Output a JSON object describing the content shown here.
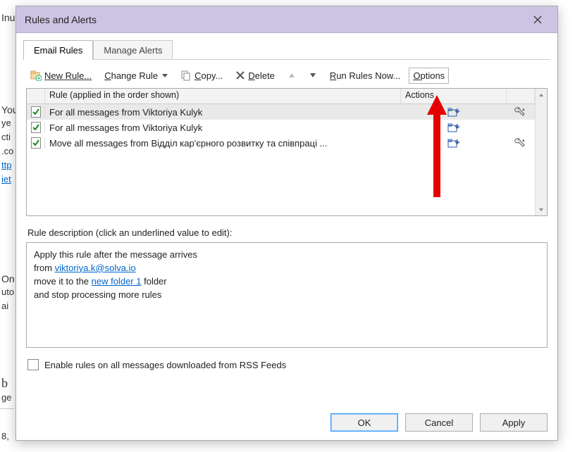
{
  "background": {
    "l1": "Inu",
    "l2": "You",
    "l3": "ye",
    "l4": "cti",
    "l5": ".co",
    "l6": "ttp",
    "l7": "iet",
    "l8": "On",
    "l9": "uto",
    "l10": "ai",
    "l11": "b",
    "l12": "ge",
    "l13": "8,"
  },
  "dialog_title": "Rules and Alerts",
  "tabs": [
    "Email Rules",
    "Manage Alerts"
  ],
  "active_tab": 0,
  "toolbar": {
    "new_rule": "New Rule...",
    "change_rule": "Change Rule",
    "copy": "Copy...",
    "delete": "Delete",
    "run_rules": "Run Rules Now...",
    "options": "Options"
  },
  "columns": {
    "rule": "Rule (applied in the order shown)",
    "actions": "Actions"
  },
  "rules": [
    {
      "checked": true,
      "selected": true,
      "name": "For all messages from Viktoriya Kulyk",
      "has_action_icon": true,
      "has_tool_icon": true
    },
    {
      "checked": true,
      "selected": false,
      "name": "For all messages from Viktoriya Kulyk",
      "has_action_icon": true,
      "has_tool_icon": false
    },
    {
      "checked": true,
      "selected": false,
      "name": "Move all messages from Відділ кар'єрного розвитку та співпраці ...",
      "has_action_icon": true,
      "has_tool_icon": true
    }
  ],
  "description_label": "Rule description (click an underlined value to edit):",
  "description": {
    "line1": "Apply this rule after the message arrives",
    "line2a": "from ",
    "line2_link": "viktoriya.k@solva.io",
    "line3a": "move it to the ",
    "line3_link": "new folder 1",
    "line3b": " folder",
    "line4": " and stop processing more rules"
  },
  "rss_checkbox_label": "Enable rules on all messages downloaded from RSS Feeds",
  "rss_checked": false,
  "buttons": {
    "ok": "OK",
    "cancel": "Cancel",
    "apply": "Apply"
  }
}
